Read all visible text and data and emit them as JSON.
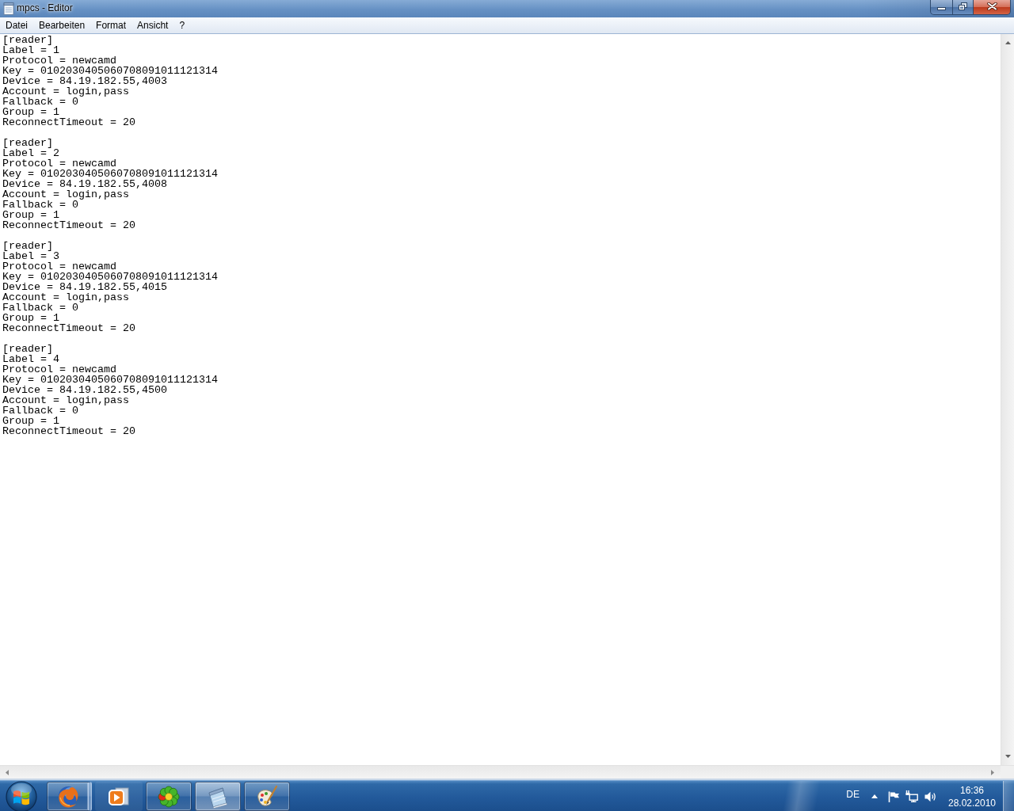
{
  "window": {
    "title": "mpcs - Editor"
  },
  "menu": [
    "Datei",
    "Bearbeiten",
    "Format",
    "Ansicht",
    "?"
  ],
  "document": {
    "blocks": [
      {
        "lines": [
          "[reader]",
          "Label = 1",
          "Protocol = newcamd",
          "Key = 0102030405060708091011121314",
          "Device = 84.19.182.55,4003",
          "Account = login,pass",
          "Fallback = 0",
          "Group = 1",
          "ReconnectTimeout = 20"
        ]
      },
      {
        "lines": [
          "[reader]",
          "Label = 2",
          "Protocol = newcamd",
          "Key = 0102030405060708091011121314",
          "Device = 84.19.182.55,4008",
          "Account = login,pass",
          "Fallback = 0",
          "Group = 1",
          "ReconnectTimeout = 20"
        ]
      },
      {
        "lines": [
          "[reader]",
          "Label = 3",
          "Protocol = newcamd",
          "Key = 0102030405060708091011121314",
          "Device = 84.19.182.55,4015",
          "Account = login,pass",
          "Fallback = 0",
          "Group = 1",
          "ReconnectTimeout = 20"
        ]
      },
      {
        "lines": [
          "[reader]",
          "Label = 4",
          "Protocol = newcamd",
          "Key = 0102030405060708091011121314",
          "Device = 84.19.182.55,4500",
          "Account = login,pass",
          "Fallback = 0",
          "Group = 1",
          "ReconnectTimeout = 20"
        ]
      }
    ]
  },
  "taskbar": {
    "buttons": [
      {
        "kind": "firefox",
        "selected": false,
        "running": true,
        "stacked": true
      },
      {
        "kind": "media",
        "selected": false,
        "running": false,
        "stacked": false
      },
      {
        "kind": "flower",
        "selected": false,
        "running": true,
        "stacked": false
      },
      {
        "kind": "notepad",
        "selected": true,
        "running": true,
        "stacked": false
      },
      {
        "kind": "paint",
        "selected": false,
        "running": true,
        "stacked": false
      }
    ],
    "tray": {
      "language": "DE",
      "time": "16:36",
      "date": "28.02.2010"
    }
  }
}
